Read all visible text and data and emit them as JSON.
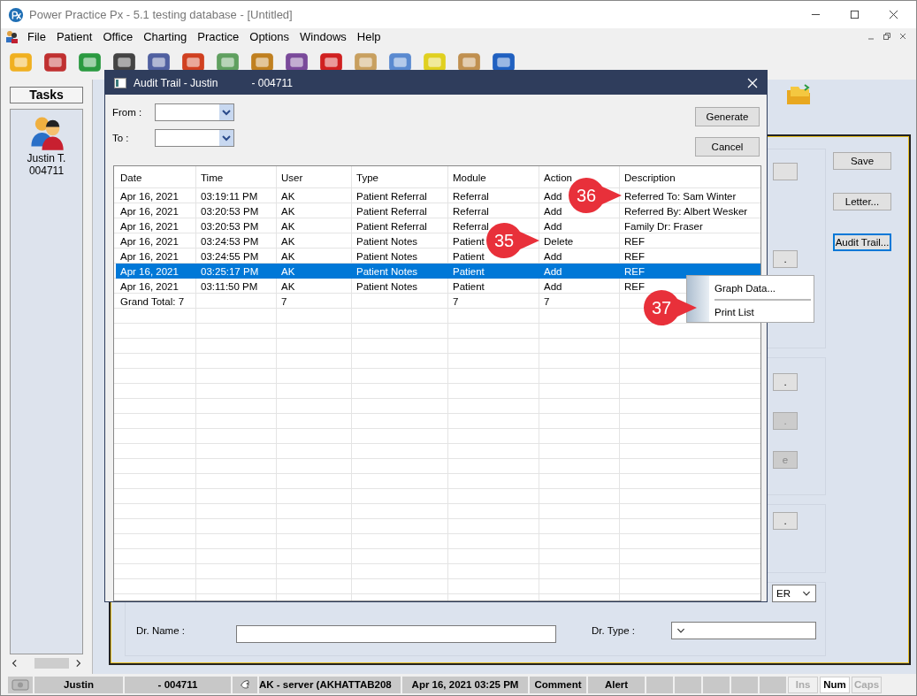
{
  "window": {
    "title": "Power Practice Px - 5.1 testing database - [Untitled]"
  },
  "menu": [
    "File",
    "Patient",
    "Office",
    "Charting",
    "Practice",
    "Options",
    "Windows",
    "Help"
  ],
  "sidebar": {
    "header": "Tasks",
    "patient_name": "Justin T.",
    "patient_id": "004711"
  },
  "form": {
    "groups": [
      {
        "buttons": [
          {
            "disabled": false
          },
          {
            "label": ".",
            "disabled": false
          }
        ]
      },
      {
        "buttons": [
          {
            "label": ".",
            "disabled": false
          },
          {
            "label": ".",
            "disabled": true
          },
          {
            "label": "e",
            "disabled": true
          }
        ]
      },
      {
        "buttons": [
          {
            "label": ".",
            "disabled": false
          }
        ]
      }
    ],
    "referral_value": "ER",
    "dr_name_label": "Dr. Name :",
    "dr_type_label": "Dr. Type :",
    "side_buttons": [
      {
        "label": "Save",
        "focused": false
      },
      {
        "label": "Letter...",
        "focused": false
      },
      {
        "label": "Audit Trail...",
        "focused": true
      }
    ]
  },
  "dialog": {
    "title_name": "Audit Trail - Justin",
    "title_id": "- 004711",
    "from_label": "From :",
    "to_label": "To :",
    "buttons": [
      "Generate",
      "Cancel"
    ],
    "table": {
      "columns": [
        "Date",
        "Time",
        "User",
        "Type",
        "Module",
        "Action",
        "Description"
      ],
      "rows": [
        {
          "cells": [
            "Apr 16, 2021",
            "03:19:11 PM",
            "AK",
            "Patient Referral",
            "Referral",
            "Add",
            "Referred To: Sam Winter"
          ],
          "selected": false
        },
        {
          "cells": [
            "Apr 16, 2021",
            "03:20:53 PM",
            "AK",
            "Patient Referral",
            "Referral",
            "Add",
            "Referred By: Albert Wesker"
          ],
          "selected": false
        },
        {
          "cells": [
            "Apr 16, 2021",
            "03:20:53 PM",
            "AK",
            "Patient Referral",
            "Referral",
            "Add",
            "Family Dr: Fraser"
          ],
          "selected": false
        },
        {
          "cells": [
            "Apr 16, 2021",
            "03:24:53 PM",
            "AK",
            "Patient Notes",
            "Patient",
            "Delete",
            "REF"
          ],
          "selected": false
        },
        {
          "cells": [
            "Apr 16, 2021",
            "03:24:55 PM",
            "AK",
            "Patient Notes",
            "Patient",
            "Add",
            "REF"
          ],
          "selected": false
        },
        {
          "cells": [
            "Apr 16, 2021",
            "03:25:17 PM",
            "AK",
            "Patient Notes",
            "Patient",
            "Add",
            "REF"
          ],
          "selected": true
        },
        {
          "cells": [
            "Apr 16, 2021",
            "03:11:50 PM",
            "AK",
            "Patient Notes",
            "Patient",
            "Add",
            "REF"
          ],
          "selected": false
        }
      ],
      "total": {
        "date": "Grand Total: 7",
        "user": "7",
        "module": "7",
        "action": "7"
      }
    }
  },
  "context_menu": [
    "Graph Data...",
    "Print List"
  ],
  "callouts": [
    "36",
    "35",
    "37"
  ],
  "status_bar": {
    "user": "Justin",
    "patient_id": "- 004711",
    "server": "AK - server (AKHATTAB208",
    "datetime": "Apr 16, 2021 03:25 PM",
    "comment": "Comment",
    "alert": "Alert",
    "indicators": [
      {
        "label": "Ins",
        "on": false
      },
      {
        "label": "Num",
        "on": true
      },
      {
        "label": "Caps",
        "on": false
      }
    ]
  }
}
